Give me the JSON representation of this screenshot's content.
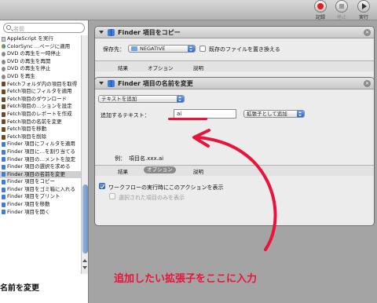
{
  "toolbar": {
    "record_label": "記録",
    "stop_label": "停止",
    "run_label": "実行"
  },
  "library": {
    "search_placeholder": "名前",
    "items": [
      {
        "label": "AppleScript を実行",
        "icon": "script-icon"
      },
      {
        "label": "ColorSync …ページに適用",
        "icon": "colorsync-icon"
      },
      {
        "label": "DVD の再生を一時停止",
        "icon": "dvd-icon"
      },
      {
        "label": "DVD の再生を再開",
        "icon": "dvd-icon"
      },
      {
        "label": "DVD の再生を停止",
        "icon": "dvd-icon"
      },
      {
        "label": "DVD を再生",
        "icon": "dvd-icon"
      },
      {
        "label": "Fetchフォルダ内の項目を取得",
        "icon": "fetch-icon"
      },
      {
        "label": "Fetch項目にフィルタを適用",
        "icon": "fetch-icon"
      },
      {
        "label": "Fetch項目のダウンロード",
        "icon": "fetch-icon"
      },
      {
        "label": "Fetch項目の…ションを設定",
        "icon": "fetch-icon"
      },
      {
        "label": "Fetch項目のレポートを作成",
        "icon": "fetch-icon"
      },
      {
        "label": "Fetch項目の名前を変更",
        "icon": "fetch-icon"
      },
      {
        "label": "Fetch項目を移動",
        "icon": "fetch-icon"
      },
      {
        "label": "Fetch項目を削除",
        "icon": "fetch-icon"
      },
      {
        "label": "Finder 項目にフィルタを適用",
        "icon": "finder-icon"
      },
      {
        "label": "Finder 項目に…を割り当てる",
        "icon": "finder-icon"
      },
      {
        "label": "Finder 項目の…メントを設定",
        "icon": "finder-icon"
      },
      {
        "label": "Finder 項目の選択を求める",
        "icon": "finder-icon"
      },
      {
        "label": "Finder 項目の名前を変更",
        "icon": "finder-icon",
        "selected": true
      },
      {
        "label": "Finder 項目をコピー",
        "icon": "finder-icon"
      },
      {
        "label": "Finder 項目をゴミ箱に入れる",
        "icon": "finder-icon"
      },
      {
        "label": "Finder 項目をプリント",
        "icon": "finder-icon"
      },
      {
        "label": "Finder 項目を移動",
        "icon": "finder-icon"
      },
      {
        "label": "Finder 項目を開く",
        "icon": "finder-icon"
      }
    ],
    "footer_title": "名前を変更"
  },
  "copy_action": {
    "title": "Finder 項目をコピー",
    "dest_label": "保存先：",
    "dest_value": "NEGATIVE",
    "replace_checkbox_label": "既存のファイルを置き換える",
    "tabs": [
      "結果",
      "オプション",
      "説明"
    ]
  },
  "rename_action": {
    "title": "Finder 項目の名前を変更",
    "mode_value": "テキストを追加",
    "add_text_label": "追加するテキスト：",
    "add_text_value": "ai",
    "position_value": "拡張子として追加",
    "example_label": "例：",
    "example_value": "項目名.xxx.ai",
    "tabs": [
      "結果",
      "オプション",
      "説明"
    ],
    "show_action_label": "ワークフローの実行時にこのアクションを表示",
    "selected_only_label": "選択された項目のみを表示"
  },
  "annotation": {
    "text": "追加したい拡張子をここに入力",
    "color": "#e8143c"
  }
}
